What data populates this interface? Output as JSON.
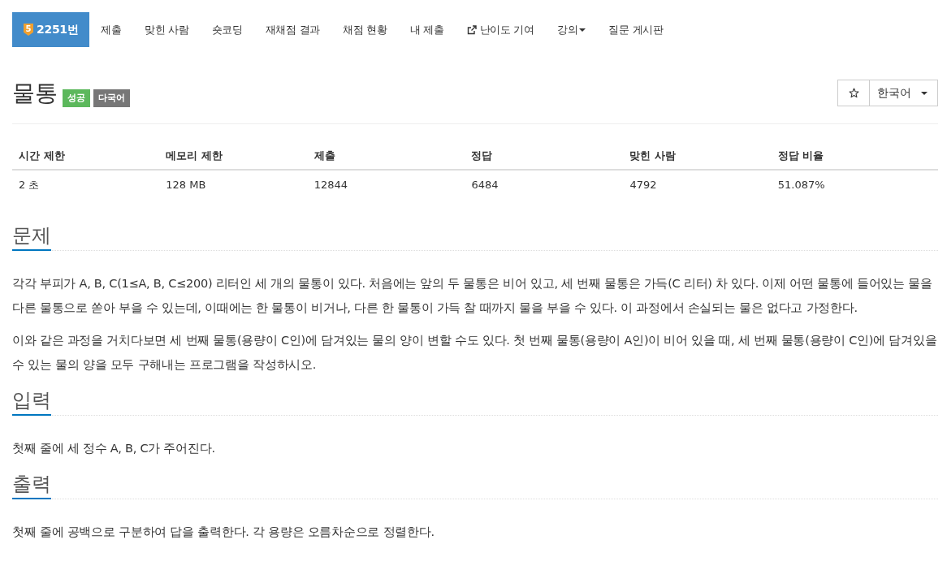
{
  "nav": {
    "tabs": [
      {
        "label": "2251번",
        "selected": true,
        "kind": "tier",
        "tier": "5"
      },
      {
        "label": "제출",
        "selected": false,
        "kind": "plain"
      },
      {
        "label": "맞힌 사람",
        "selected": false,
        "kind": "plain"
      },
      {
        "label": "숏코딩",
        "selected": false,
        "kind": "plain"
      },
      {
        "label": "재채점 결과",
        "selected": false,
        "kind": "plain"
      },
      {
        "label": "채점 현황",
        "selected": false,
        "kind": "plain"
      },
      {
        "label": "내 제출",
        "selected": false,
        "kind": "plain"
      },
      {
        "label": "난이도 기여",
        "selected": false,
        "kind": "external"
      },
      {
        "label": "강의",
        "selected": false,
        "kind": "dropdown"
      },
      {
        "label": "질문 게시판",
        "selected": false,
        "kind": "plain"
      }
    ]
  },
  "problem": {
    "title": "물통",
    "badges": [
      {
        "label": "성공",
        "color": "#5cb85c"
      },
      {
        "label": "다국어",
        "color": "#777777"
      }
    ]
  },
  "language_select": {
    "value": "한국어"
  },
  "limits_table": {
    "columns": [
      "시간 제한",
      "메모리 제한",
      "제출",
      "정답",
      "맞힌 사람",
      "정답 비율"
    ],
    "rows": [
      [
        "2 초",
        "128 MB",
        "12844",
        "6484",
        "4792",
        "51.087%"
      ]
    ]
  },
  "sections": [
    {
      "heading": "문제",
      "paragraphs": [
        "각각 부피가 A, B, C(1≤A, B, C≤200) 리터인 세 개의 물통이 있다. 처음에는 앞의 두 물통은 비어 있고, 세 번째 물통은 가득(C 리터) 차 있다. 이제 어떤 물통에 들어있는 물을 다른 물통으로 쏟아 부을 수 있는데, 이때에는 한 물통이 비거나, 다른 한 물통이 가득 찰 때까지 물을 부을 수 있다. 이 과정에서 손실되는 물은 없다고 가정한다.",
        "이와 같은 과정을 거치다보면 세 번째 물통(용량이 C인)에 담겨있는 물의 양이 변할 수도 있다. 첫 번째 물통(용량이 A인)이 비어 있을 때, 세 번째 물통(용량이 C인)에 담겨있을 수 있는 물의 양을 모두 구해내는 프로그램을 작성하시오."
      ]
    },
    {
      "heading": "입력",
      "paragraphs": [
        "첫째 줄에 세 정수 A, B, C가 주어진다."
      ]
    },
    {
      "heading": "출력",
      "paragraphs": [
        "첫째 줄에 공백으로 구분하여 답을 출력한다. 각 용량은 오름차순으로 정렬한다."
      ]
    }
  ]
}
